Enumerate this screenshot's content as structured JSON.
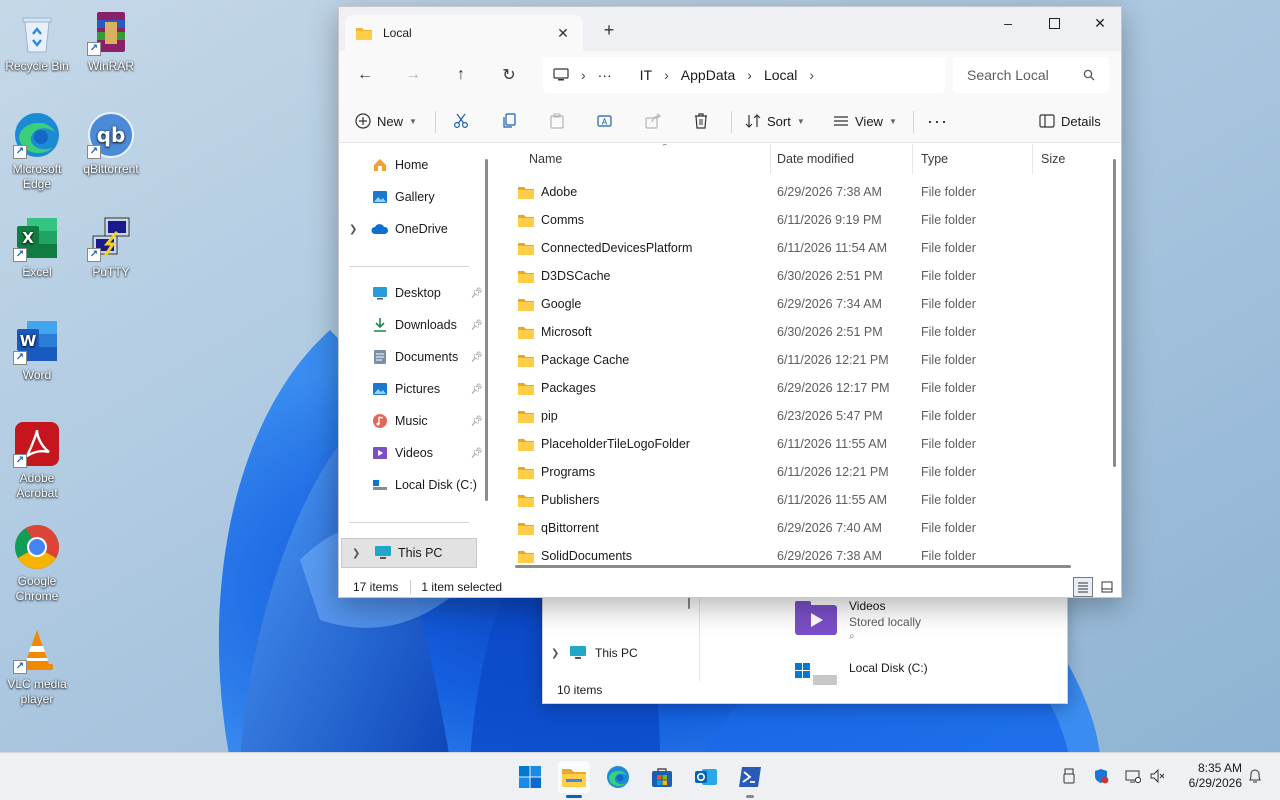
{
  "desktop": {
    "icons": [
      {
        "label": "Recycle Bin"
      },
      {
        "label": "WinRAR"
      },
      {
        "label": "Microsoft Edge"
      },
      {
        "label": "qBittorrent"
      },
      {
        "label": "Excel"
      },
      {
        "label": "PuTTY"
      },
      {
        "label": "Word"
      },
      {
        "label": "Adobe Acrobat"
      },
      {
        "label": "Google Chrome"
      },
      {
        "label": "VLC media player"
      }
    ]
  },
  "background_window": {
    "nav_this_pc": "This PC",
    "tile1_title": "Videos",
    "tile1_sub": "Stored locally",
    "tile2_title": "Local Disk (C:)",
    "status": "10 items"
  },
  "explorer": {
    "tab_title": "Local",
    "breadcrumb": [
      "IT",
      "AppData",
      "Local"
    ],
    "search_placeholder": "Search Local",
    "toolbar": {
      "new_label": "New",
      "sort_label": "Sort",
      "view_label": "View",
      "more_label": "···",
      "details_label": "Details"
    },
    "nav": {
      "home": "Home",
      "gallery": "Gallery",
      "onedrive": "OneDrive",
      "desktop": "Desktop",
      "downloads": "Downloads",
      "documents": "Documents",
      "pictures": "Pictures",
      "music": "Music",
      "videos": "Videos",
      "local_disk": "Local Disk (C:)",
      "this_pc": "This PC"
    },
    "columns": {
      "name": "Name",
      "date": "Date modified",
      "type": "Type",
      "size": "Size"
    },
    "files": [
      {
        "name": "Adobe",
        "date": "6/29/2026 7:38 AM",
        "type": "File folder"
      },
      {
        "name": "Comms",
        "date": "6/11/2026 9:19 PM",
        "type": "File folder"
      },
      {
        "name": "ConnectedDevicesPlatform",
        "date": "6/11/2026 11:54 AM",
        "type": "File folder"
      },
      {
        "name": "D3DSCache",
        "date": "6/30/2026 2:51 PM",
        "type": "File folder"
      },
      {
        "name": "Google",
        "date": "6/29/2026 7:34 AM",
        "type": "File folder"
      },
      {
        "name": "Microsoft",
        "date": "6/30/2026 2:51 PM",
        "type": "File folder"
      },
      {
        "name": "Package Cache",
        "date": "6/11/2026 12:21 PM",
        "type": "File folder"
      },
      {
        "name": "Packages",
        "date": "6/29/2026 12:17 PM",
        "type": "File folder"
      },
      {
        "name": "pip",
        "date": "6/23/2026 5:47 PM",
        "type": "File folder"
      },
      {
        "name": "PlaceholderTileLogoFolder",
        "date": "6/11/2026 11:55 AM",
        "type": "File folder"
      },
      {
        "name": "Programs",
        "date": "6/11/2026 12:21 PM",
        "type": "File folder"
      },
      {
        "name": "Publishers",
        "date": "6/11/2026 11:55 AM",
        "type": "File folder"
      },
      {
        "name": "qBittorrent",
        "date": "6/29/2026 7:40 AM",
        "type": "File folder"
      },
      {
        "name": "SolidDocuments",
        "date": "6/29/2026 7:38 AM",
        "type": "File folder"
      }
    ],
    "status": {
      "count": "17 items",
      "selected": "1 item selected"
    }
  },
  "taskbar": {
    "time": "8:35 AM",
    "date": "6/29/2026"
  }
}
